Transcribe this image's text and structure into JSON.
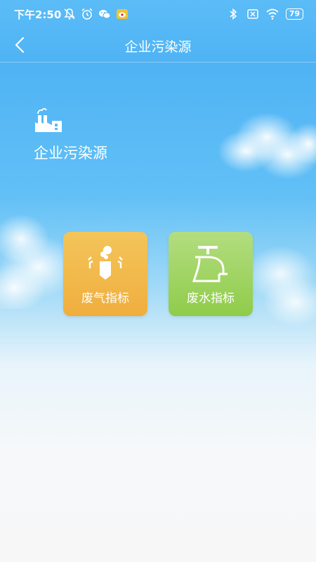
{
  "status": {
    "time": "下午2:50",
    "battery": "79",
    "icons_left": [
      "notification-off-icon",
      "alarm-icon",
      "wechat-icon",
      "weibo-icon"
    ],
    "icons_right": [
      "bluetooth-icon",
      "no-sim-icon",
      "wifi-icon",
      "battery-icon"
    ]
  },
  "header": {
    "title": "企业污染源",
    "back_icon": "chevron-left-icon"
  },
  "section": {
    "icon": "factory-icon",
    "title": "企业污染源"
  },
  "tiles": [
    {
      "label": "废气指标",
      "icon": "chimney-smoke-icon",
      "color": "#f1b445"
    },
    {
      "label": "废水指标",
      "icon": "faucet-icon",
      "color": "#9ad356"
    }
  ],
  "colors": {
    "sky_top": "#5bbcf7",
    "text": "#ffffff"
  }
}
